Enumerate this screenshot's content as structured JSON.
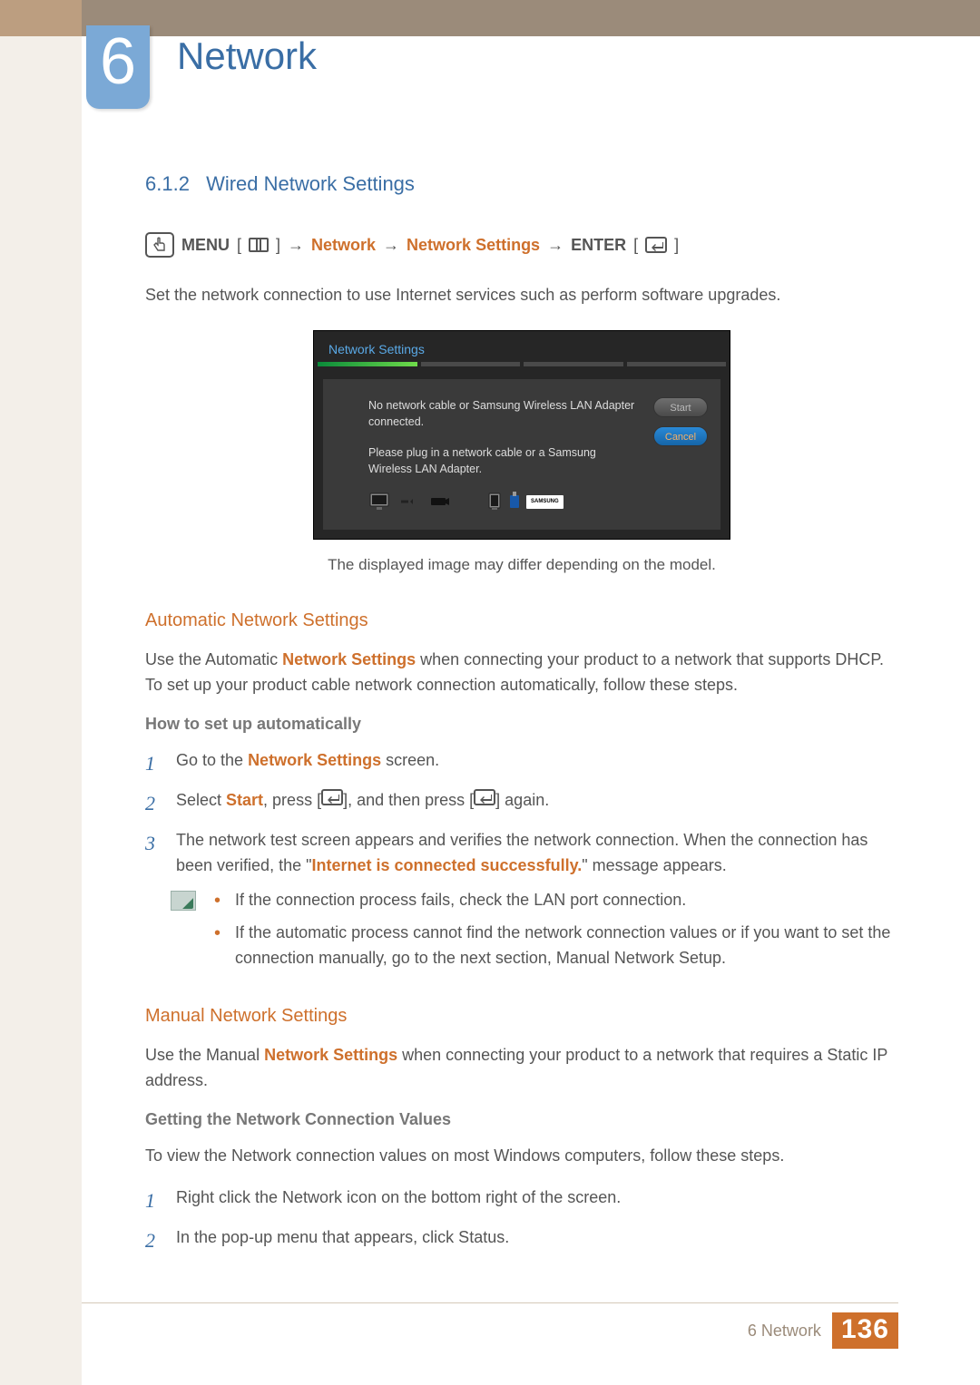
{
  "chapter": {
    "number": "6",
    "title": "Network"
  },
  "section": {
    "number": "6.1.2",
    "title": "Wired Network Settings"
  },
  "menuPath": {
    "menu": "MENU",
    "seg1": "Network",
    "seg2": "Network Settings",
    "enter": "ENTER",
    "arrow": "→"
  },
  "intro": "Set the network connection to use Internet services such as perform software upgrades.",
  "screenshot": {
    "title": "Network Settings",
    "msg1": "No network cable or Samsung Wireless LAN Adapter connected.",
    "msg2": "Please plug in a network cable or a Samsung Wireless LAN Adapter.",
    "btnStart": "Start",
    "btnCancel": "Cancel",
    "samsungLabel": "SAMSUNG"
  },
  "caption": "The displayed image may differ depending on the model.",
  "auto": {
    "heading": "Automatic Network Settings",
    "para1a": "Use the Automatic ",
    "para1b": "Network Settings",
    "para1c": " when connecting your product to a network that supports DHCP. To set up your product cable network connection automatically, follow these steps.",
    "howto": "How to set up automatically",
    "step1a": "Go to the ",
    "step1b": "Network Settings",
    "step1c": " screen.",
    "step2a": "Select ",
    "step2b": "Start",
    "step2c": ", press [",
    "step2d": "], and then press [",
    "step2e": "] again.",
    "step3a": "The network test screen appears and verifies the network connection. When the connection has been verified, the \"",
    "step3b": "Internet is connected successfully.",
    "step3c": "\" message appears.",
    "note1": "If the connection process fails, check the LAN port connection.",
    "note2": "If the automatic process cannot find the network connection values or if you want to set the connection manually, go to the next section, Manual Network Setup."
  },
  "manual": {
    "heading": "Manual Network Settings",
    "para1a": "Use the Manual ",
    "para1b": "Network Settings",
    "para1c": " when connecting your product to a network that requires a Static IP address.",
    "subheading": "Getting the Network Connection Values",
    "intro": "To view the Network connection values on most Windows computers, follow these steps.",
    "step1": "Right click the Network icon on the bottom right of the screen.",
    "step2": "In the pop-up menu that appears, click Status."
  },
  "footer": {
    "label": "6 Network",
    "page": "136"
  },
  "nums": {
    "n1": "1",
    "n2": "2",
    "n3": "3"
  }
}
